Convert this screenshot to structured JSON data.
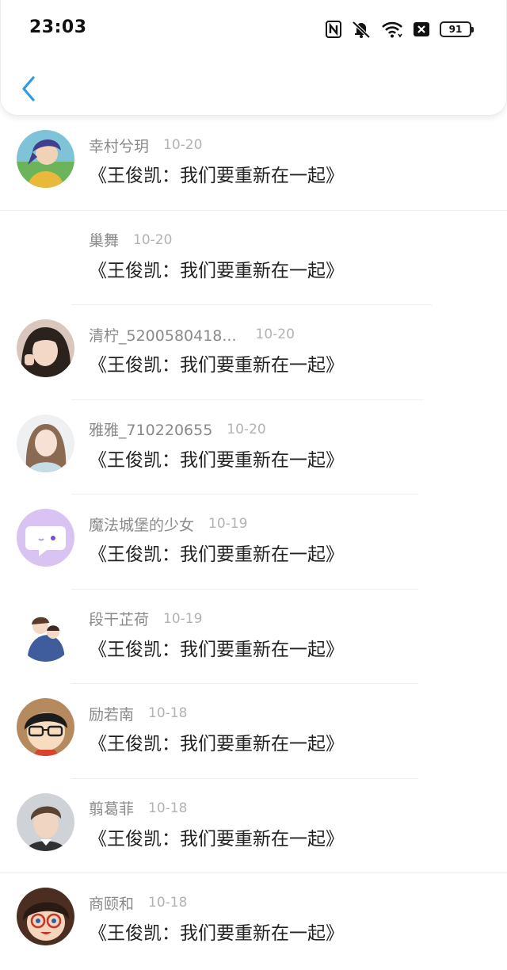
{
  "status_bar": {
    "time": "23:03",
    "battery": "91",
    "icons": [
      "nfc-icon",
      "mute-bell-icon",
      "wifi-icon",
      "close-box-icon",
      "battery-icon"
    ]
  },
  "nav": {
    "back_icon": "chevron-left-icon",
    "accent_color": "#2f9be8"
  },
  "list": [
    {
      "name": "幸村兮玥",
      "date": "10-20",
      "message": "《王俊凯：我们要重新在一起》",
      "avatar": "anime-boy-avatar"
    },
    {
      "name": "巢舞",
      "date": "10-20",
      "message": "《王俊凯：我们要重新在一起》",
      "avatar": ""
    },
    {
      "name": "清柠_5200580418...",
      "date": "10-20",
      "message": "《王俊凯：我们要重新在一起》",
      "avatar": "girl-photo-avatar"
    },
    {
      "name": "雅雅_710220655",
      "date": "10-20",
      "message": "《王俊凯：我们要重新在一起》",
      "avatar": "girl-photo-avatar"
    },
    {
      "name": "魔法城堡的少女",
      "date": "10-19",
      "message": "《王俊凯：我们要重新在一起》",
      "avatar": "chat-bubble-avatar"
    },
    {
      "name": "段干芷荷",
      "date": "10-19",
      "message": "《王俊凯：我们要重新在一起》",
      "avatar": "anime-couple-avatar"
    },
    {
      "name": "励若南",
      "date": "10-18",
      "message": "《王俊凯：我们要重新在一起》",
      "avatar": "anime-glasses-avatar"
    },
    {
      "name": "翦葛菲",
      "date": "10-18",
      "message": "《王俊凯：我们要重新在一起》",
      "avatar": "boy-photo-avatar"
    },
    {
      "name": "商颐和",
      "date": "10-18",
      "message": "《王俊凯：我们要重新在一起》",
      "avatar": "anime-detective-avatar"
    }
  ]
}
